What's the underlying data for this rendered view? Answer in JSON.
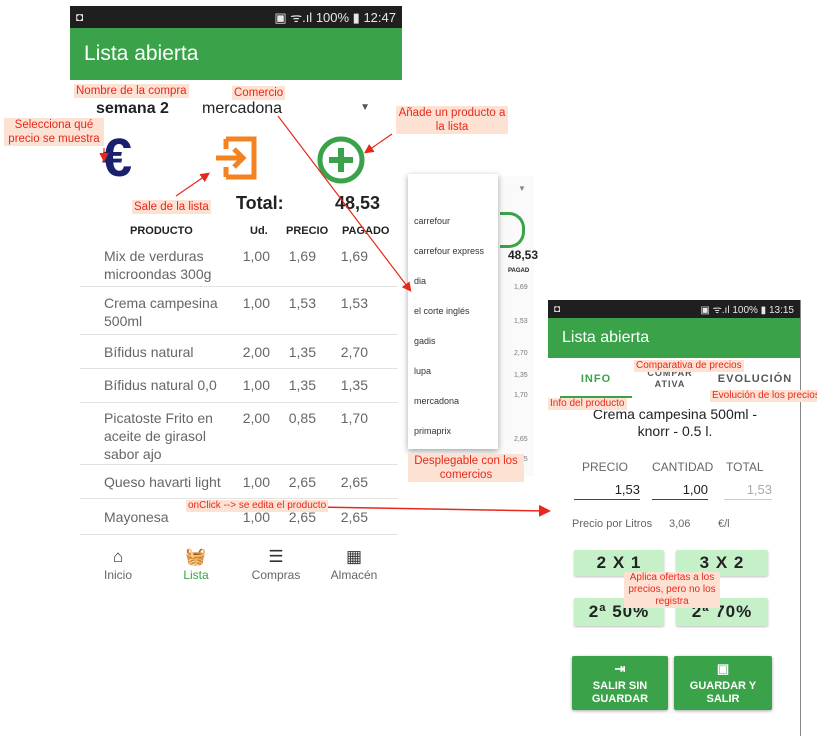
{
  "left_screen": {
    "status": {
      "text": "100%",
      "time": "12:47"
    },
    "appbar_title": "Lista abierta",
    "purchase_name": "semana 2",
    "store": "mercadona",
    "total_label": "Total:",
    "total_value": "48,53",
    "columns": [
      "PRODUCTO",
      "Ud.",
      "PRECIO",
      "PAGADO"
    ],
    "rows": [
      {
        "product": "Mix de verduras microondas 300g",
        "units": "1,00",
        "price": "1,69",
        "paid": "1,69"
      },
      {
        "product": "Crema campesina 500ml",
        "units": "1,00",
        "price": "1,53",
        "paid": "1,53"
      },
      {
        "product": "Bífidus natural",
        "units": "2,00",
        "price": "1,35",
        "paid": "2,70"
      },
      {
        "product": "Bífidus natural 0,0",
        "units": "1,00",
        "price": "1,35",
        "paid": "1,35"
      },
      {
        "product": "Picatoste Frito en aceite de girasol sabor ajo",
        "units": "2,00",
        "price": "0,85",
        "paid": "1,70"
      },
      {
        "product": "Queso havarti light",
        "units": "1,00",
        "price": "2,65",
        "paid": "2,65"
      },
      {
        "product": "Mayonesa",
        "units": "1,00",
        "price": "2,65",
        "paid": "2,65"
      }
    ],
    "nav": [
      "Inicio",
      "Lista",
      "Compras",
      "Almacén"
    ]
  },
  "dropdown": {
    "items": [
      "carrefour",
      "carrefour express",
      "dia",
      "el corte inglés",
      "gadis",
      "lupa",
      "mercadona",
      "primaprix"
    ],
    "peek_total": "48,53",
    "peek_header": "PAGAD",
    "peek_values": [
      "1,69",
      "1,53",
      "2,70",
      "1,35",
      "1,70",
      "2,65",
      "2,65"
    ]
  },
  "right_screen": {
    "status": {
      "text": "100%",
      "time": "13:15"
    },
    "appbar_title": "Lista abierta",
    "tabs": [
      "INFO",
      "COMPARATIVA",
      "EVOLUCIÓN"
    ],
    "product_title": "Crema campesina 500ml - knorr - 0.5 l.",
    "field_labels": [
      "PRECIO",
      "CANTIDAD",
      "TOTAL"
    ],
    "field_values": [
      "1,53",
      "1,00",
      "1,53"
    ],
    "unit_price_label": "Precio por Litros",
    "unit_price_value": "3,06",
    "unit_price_unit": "€/l",
    "offers": [
      "2 X 1",
      "3 X 2",
      "2ª 50%",
      "2ª 70%"
    ],
    "exit_button": "SALIR SIN GUARDAR",
    "save_button": "GUARDAR Y SALIR"
  },
  "annotations": {
    "nombre": "Nombre de la compra",
    "comercio": "Comercio",
    "selecciona": "Selecciona qué precio se muestra",
    "anade": "Añade un producto a la lista",
    "sale": "Sale de la lista",
    "desplegable": "Desplegable con los comercios",
    "onclick": "onClick --> se edita el producto",
    "comparativa": "Comparativa de precios",
    "info": "Info del producto",
    "evolucion": "Evolución de los precios",
    "ofertas": "Aplica ofertas a los precios, pero no los registra"
  },
  "colors": {
    "primary": "#3aa34a",
    "accent_orange": "#f58220",
    "euro_navy": "#1a1f6e",
    "annotation_red": "#e8281d"
  }
}
